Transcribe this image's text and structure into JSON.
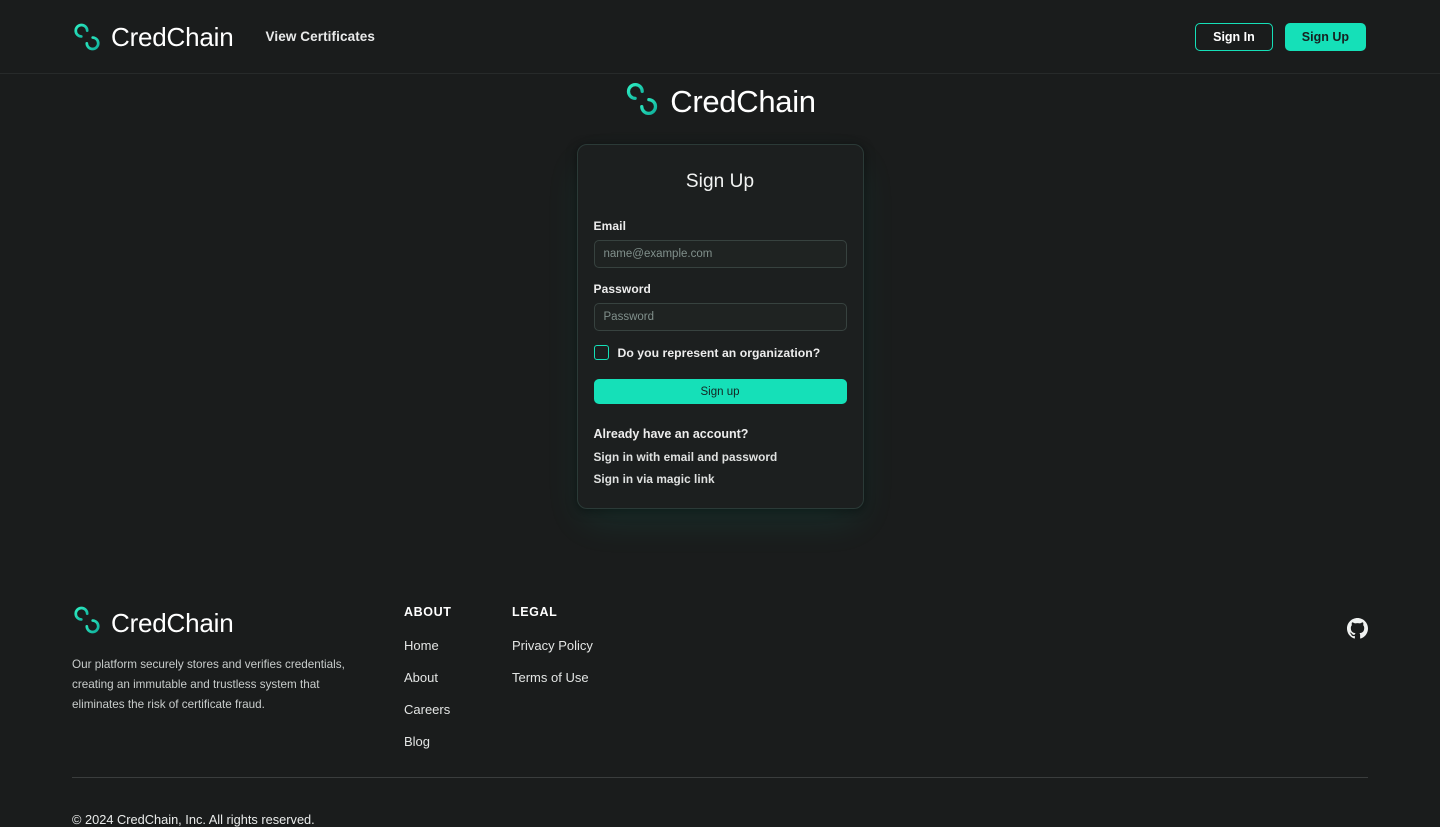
{
  "brand": {
    "name": "CredChain",
    "logo_icon": "credchain-s-logo-icon",
    "accent_color": "#15e0b8",
    "page_background": "#1a1c1c",
    "card_background": "#1c1f1f"
  },
  "header": {
    "nav_link": "View Certificates",
    "sign_in_label": "Sign In",
    "sign_up_label": "Sign Up"
  },
  "hero": {
    "brand_name": "CredChain"
  },
  "auth_card": {
    "title": "Sign Up",
    "email": {
      "label": "Email",
      "placeholder": "name@example.com",
      "value": ""
    },
    "password": {
      "label": "Password",
      "placeholder": "Password",
      "value": ""
    },
    "organization_checkbox": {
      "label": "Do you represent an organization?",
      "checked": false
    },
    "submit_label": "Sign up",
    "alt_heading": "Already have an account?",
    "alt_links": [
      "Sign in with email and password",
      "Sign in via magic link"
    ]
  },
  "footer": {
    "brand_name": "CredChain",
    "description": "Our platform securely stores and verifies credentials, creating an immutable and trustless system that eliminates the risk of certificate fraud.",
    "columns": [
      {
        "title": "ABOUT",
        "links": [
          "Home",
          "About",
          "Careers",
          "Blog"
        ]
      },
      {
        "title": "LEGAL",
        "links": [
          "Privacy Policy",
          "Terms of Use"
        ]
      }
    ],
    "social": {
      "github_icon": "github-icon"
    },
    "copyright": "© 2024 CredChain, Inc. All rights reserved."
  }
}
